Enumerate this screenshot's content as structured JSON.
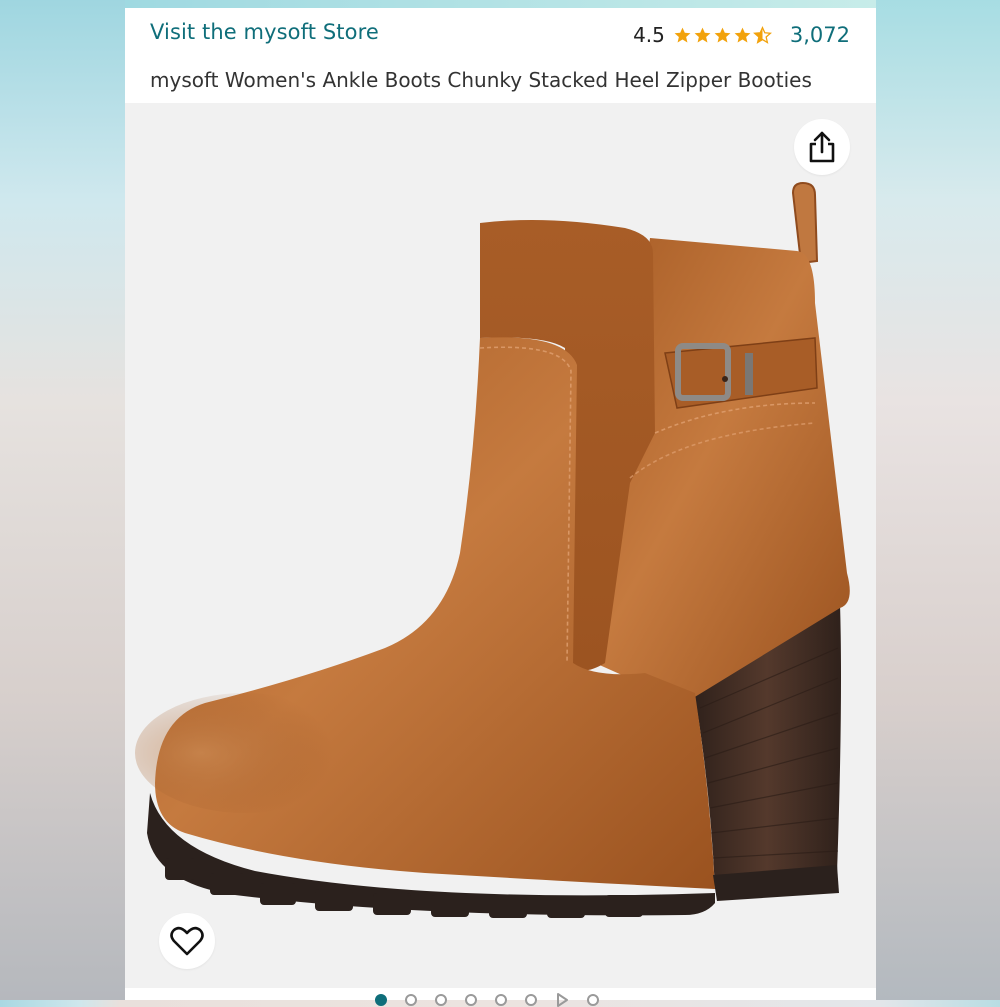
{
  "store": {
    "link_text": "Visit the mysoft Store"
  },
  "rating": {
    "value": "4.5",
    "stars": 4.5,
    "count": "3,072"
  },
  "product": {
    "title": "mysoft Women's Ankle Boots Chunky Stacked Heel Zipper Booties"
  },
  "icons": {
    "share": "share-icon",
    "favorite": "heart-outline-icon",
    "star": "star-icon"
  },
  "gallery": {
    "image_count": 7,
    "video_count": 1,
    "active_index": 0
  },
  "colors": {
    "link": "#0f6e7a",
    "star": "#f2a20c",
    "boot_leather": "#b8692f",
    "boot_sole": "#2b211d",
    "heel": "#4a3328"
  }
}
